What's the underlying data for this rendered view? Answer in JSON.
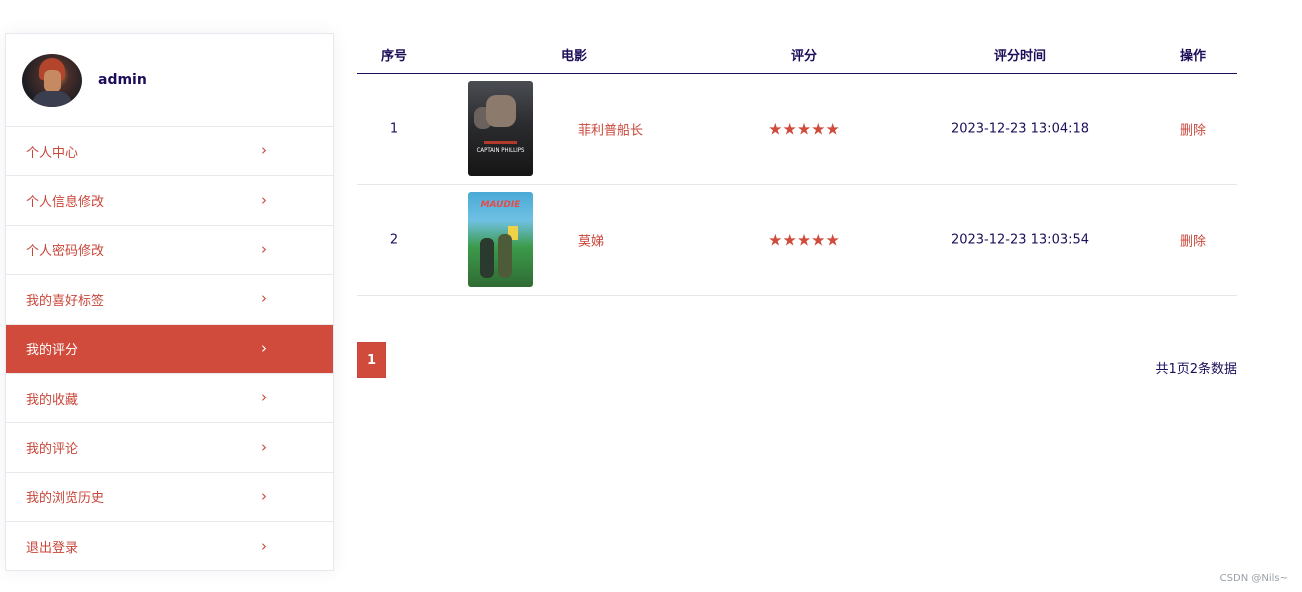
{
  "profile": {
    "username": "admin"
  },
  "menu": [
    {
      "label": "个人中心",
      "active": false
    },
    {
      "label": "个人信息修改",
      "active": false
    },
    {
      "label": "个人密码修改",
      "active": false
    },
    {
      "label": "我的喜好标签",
      "active": false
    },
    {
      "label": "我的评分",
      "active": true
    },
    {
      "label": "我的收藏",
      "active": false
    },
    {
      "label": "我的评论",
      "active": false
    },
    {
      "label": "我的浏览历史",
      "active": false
    },
    {
      "label": "退出登录",
      "active": false
    }
  ],
  "table": {
    "headers": {
      "index": "序号",
      "movie": "电影",
      "rating": "评分",
      "time": "评分时间",
      "action": "操作"
    },
    "rows": [
      {
        "index": "1",
        "title": "菲利普船长",
        "poster_title": "CAPTAIN PHILLIPS",
        "stars": 5,
        "time": "2023-12-23 13:04:18",
        "action": "删除"
      },
      {
        "index": "2",
        "title": "莫娣",
        "poster_title": "MAUDIE",
        "stars": 5,
        "time": "2023-12-23 13:03:54",
        "action": "删除"
      }
    ]
  },
  "pagination": {
    "current": "1",
    "summary": "共1页2条数据"
  },
  "watermark": "CSDN @Nils~",
  "colors": {
    "accent": "#d04b3b",
    "text": "#1e0e5a"
  }
}
